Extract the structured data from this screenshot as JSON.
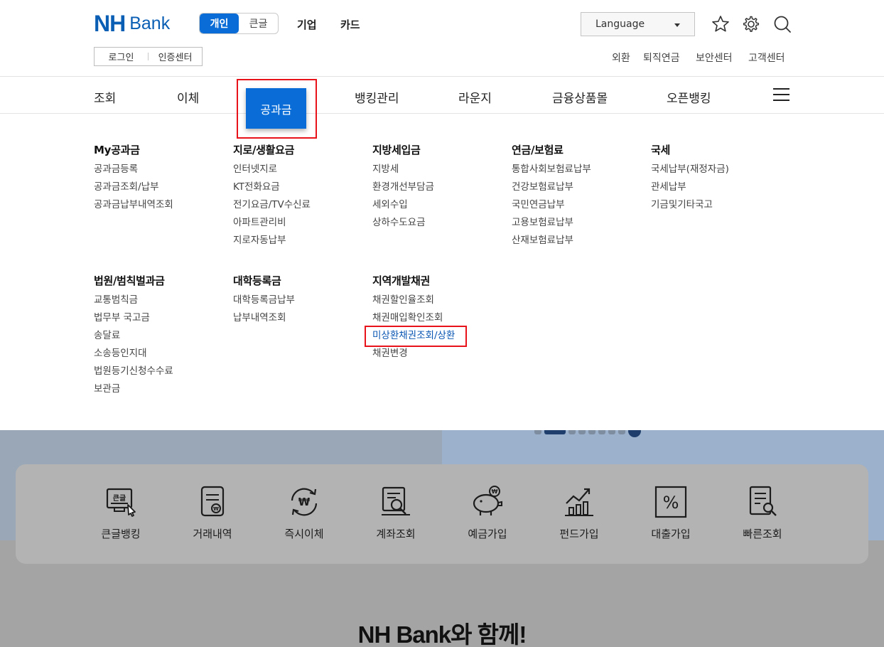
{
  "header": {
    "logo_nh": "NH",
    "logo_bank": "Bank",
    "segment": {
      "active": "개인",
      "inactive": "큰글"
    },
    "top_links": [
      "기업",
      "카드"
    ],
    "auth": {
      "login": "로그인",
      "cert": "인증센터"
    },
    "language": "Language",
    "util_links": [
      "외환",
      "퇴직연금",
      "보안센터",
      "고객센터"
    ],
    "icons": [
      "star-icon",
      "gear-icon",
      "search-icon"
    ]
  },
  "gnb": {
    "items": [
      "조회",
      "이체",
      "공과금",
      "뱅킹관리",
      "라운지",
      "금융상품몰",
      "오픈뱅킹"
    ],
    "active": "공과금"
  },
  "mega_menu": {
    "columns": [
      {
        "title": "My공과금",
        "items": [
          "공과금등록",
          "공과금조회/납부",
          "공과금납부내역조회"
        ]
      },
      {
        "title": "지로/생활요금",
        "items": [
          "인터넷지로",
          "KT전화요금",
          "전기요금/TV수신료",
          "아파트관리비",
          "지로자동납부"
        ]
      },
      {
        "title": "지방세입금",
        "items": [
          "지방세",
          "환경개선부담금",
          "세외수입",
          "상하수도요금"
        ]
      },
      {
        "title": "연금/보험료",
        "items": [
          "통합사회보험료납부",
          "건강보험료납부",
          "국민연금납부",
          "고용보험료납부",
          "산재보험료납부"
        ]
      },
      {
        "title": "국세",
        "items": [
          "국세납부(재정자금)",
          "관세납부",
          "기금및기타국고"
        ]
      },
      {
        "title": "법원/범칙벌과금",
        "items": [
          "교통범칙금",
          "법무부 국고금",
          "송달료",
          "소송등인지대",
          "법원등기신청수수료",
          "보관금"
        ]
      },
      {
        "title": "대학등록금",
        "items": [
          "대학등록금납부",
          "납부내역조회"
        ]
      },
      {
        "title": "지역개발채권",
        "items": [
          "채권할인율조회",
          "채권매입확인조회",
          "미상환채권조회/상환",
          "채권변경"
        ]
      }
    ],
    "highlighted": "미상환채권조회/상환"
  },
  "quick_menu": [
    {
      "label": "큰글뱅킹",
      "icon": "large-text-banking-icon"
    },
    {
      "label": "거래내역",
      "icon": "transaction-history-icon"
    },
    {
      "label": "즉시이체",
      "icon": "instant-transfer-icon"
    },
    {
      "label": "계좌조회",
      "icon": "account-inquiry-icon"
    },
    {
      "label": "예금가입",
      "icon": "piggy-bank-icon"
    },
    {
      "label": "펀드가입",
      "icon": "fund-chart-icon"
    },
    {
      "label": "대출가입",
      "icon": "percent-icon"
    },
    {
      "label": "빠른조회",
      "icon": "quick-search-icon"
    }
  ],
  "quick_icon_text": {
    "large_text": "큰글",
    "won": "₩",
    "percent": "%"
  },
  "bottom_title": "NH Bank와 함께!",
  "colors": {
    "brand": "#0a5fb4",
    "active_blue": "#0a6dd7",
    "highlight_red": "#e8121a"
  }
}
